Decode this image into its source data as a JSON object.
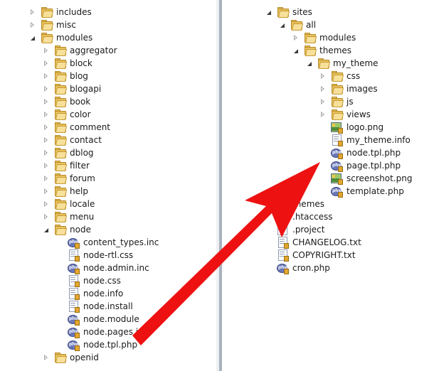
{
  "left_tree": [
    {
      "label": "includes",
      "type": "folder",
      "depth": 0,
      "state": "closed"
    },
    {
      "label": "misc",
      "type": "folder",
      "depth": 0,
      "state": "closed"
    },
    {
      "label": "modules",
      "type": "folder",
      "depth": 0,
      "state": "open"
    },
    {
      "label": "aggregator",
      "type": "folder",
      "depth": 1,
      "state": "closed"
    },
    {
      "label": "block",
      "type": "folder",
      "depth": 1,
      "state": "closed"
    },
    {
      "label": "blog",
      "type": "folder",
      "depth": 1,
      "state": "closed"
    },
    {
      "label": "blogapi",
      "type": "folder",
      "depth": 1,
      "state": "closed"
    },
    {
      "label": "book",
      "type": "folder",
      "depth": 1,
      "state": "closed"
    },
    {
      "label": "color",
      "type": "folder",
      "depth": 1,
      "state": "closed"
    },
    {
      "label": "comment",
      "type": "folder",
      "depth": 1,
      "state": "closed"
    },
    {
      "label": "contact",
      "type": "folder",
      "depth": 1,
      "state": "closed"
    },
    {
      "label": "dblog",
      "type": "folder",
      "depth": 1,
      "state": "closed"
    },
    {
      "label": "filter",
      "type": "folder",
      "depth": 1,
      "state": "closed"
    },
    {
      "label": "forum",
      "type": "folder",
      "depth": 1,
      "state": "closed"
    },
    {
      "label": "help",
      "type": "folder",
      "depth": 1,
      "state": "closed"
    },
    {
      "label": "locale",
      "type": "folder",
      "depth": 1,
      "state": "closed"
    },
    {
      "label": "menu",
      "type": "folder",
      "depth": 1,
      "state": "closed"
    },
    {
      "label": "node",
      "type": "folder",
      "depth": 1,
      "state": "open"
    },
    {
      "label": "content_types.inc",
      "type": "php",
      "depth": 2,
      "state": "none"
    },
    {
      "label": "node-rtl.css",
      "type": "file",
      "depth": 2,
      "state": "none"
    },
    {
      "label": "node.admin.inc",
      "type": "php",
      "depth": 2,
      "state": "none"
    },
    {
      "label": "node.css",
      "type": "file",
      "depth": 2,
      "state": "none"
    },
    {
      "label": "node.info",
      "type": "file",
      "depth": 2,
      "state": "none"
    },
    {
      "label": "node.install",
      "type": "file",
      "depth": 2,
      "state": "none"
    },
    {
      "label": "node.module",
      "type": "php",
      "depth": 2,
      "state": "none"
    },
    {
      "label": "node.pages.inc",
      "type": "php",
      "depth": 2,
      "state": "none"
    },
    {
      "label": "node.tpl.php",
      "type": "php",
      "depth": 2,
      "state": "none"
    },
    {
      "label": "openid",
      "type": "folder",
      "depth": 1,
      "state": "closed"
    }
  ],
  "right_tree": [
    {
      "label": "sites",
      "type": "folder",
      "depth": 0,
      "state": "open"
    },
    {
      "label": "all",
      "type": "folder",
      "depth": 1,
      "state": "open"
    },
    {
      "label": "modules",
      "type": "folder",
      "depth": 2,
      "state": "closed"
    },
    {
      "label": "themes",
      "type": "folder",
      "depth": 2,
      "state": "open"
    },
    {
      "label": "my_theme",
      "type": "folder",
      "depth": 3,
      "state": "open"
    },
    {
      "label": "css",
      "type": "folder",
      "depth": 4,
      "state": "closed"
    },
    {
      "label": "images",
      "type": "folder",
      "depth": 4,
      "state": "closed"
    },
    {
      "label": "js",
      "type": "folder",
      "depth": 4,
      "state": "closed"
    },
    {
      "label": "views",
      "type": "folder",
      "depth": 4,
      "state": "closed"
    },
    {
      "label": "logo.png",
      "type": "image",
      "depth": 4,
      "state": "none"
    },
    {
      "label": "my_theme.info",
      "type": "file",
      "depth": 4,
      "state": "none"
    },
    {
      "label": "node.tpl.php",
      "type": "php",
      "depth": 4,
      "state": "none"
    },
    {
      "label": "page.tpl.php",
      "type": "php",
      "depth": 4,
      "state": "none"
    },
    {
      "label": "screenshot.png",
      "type": "image",
      "depth": 4,
      "state": "none"
    },
    {
      "label": "template.php",
      "type": "php",
      "depth": 4,
      "state": "none"
    },
    {
      "label": "themes",
      "type": "folder",
      "depth": 0,
      "state": "closed"
    },
    {
      "label": ".htaccess",
      "type": "file",
      "depth": 0,
      "state": "none"
    },
    {
      "label": ".project",
      "type": "project",
      "depth": 0,
      "state": "none"
    },
    {
      "label": "CHANGELOG.txt",
      "type": "file",
      "depth": 0,
      "state": "none"
    },
    {
      "label": "COPYRIGHT.txt",
      "type": "file",
      "depth": 0,
      "state": "none"
    },
    {
      "label": "cron.php",
      "type": "php",
      "depth": 0,
      "state": "none"
    }
  ],
  "annotation": {
    "type": "arrow",
    "color": "#ee1111",
    "from": "left node/node.tpl.php",
    "to": "right my_theme/node.tpl.php"
  },
  "icon_glyphs": {
    "php": "php",
    "project": "Y?"
  }
}
